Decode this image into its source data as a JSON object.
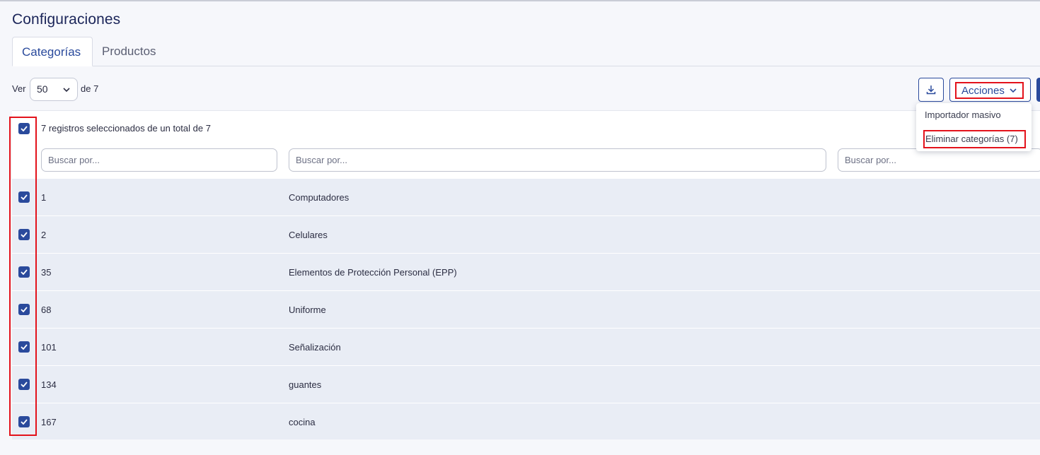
{
  "page": {
    "title": "Configuraciones"
  },
  "tabs": [
    {
      "label": "Categorías",
      "active": true
    },
    {
      "label": "Productos",
      "active": false
    }
  ],
  "pagination": {
    "ver_label": "Ver",
    "page_size": "50",
    "of_label": "de 7"
  },
  "toolbar": {
    "download_icon": "download-icon",
    "actions_label": "Acciones"
  },
  "actions_menu": {
    "items": [
      "Importador masivo",
      "Eliminar categorías (7)"
    ]
  },
  "table": {
    "selection_summary": "7 registros seleccionados de un total de 7",
    "filters": [
      {
        "placeholder": "Buscar por..."
      },
      {
        "placeholder": "Buscar por..."
      },
      {
        "placeholder": "Buscar por..."
      }
    ],
    "rows": [
      {
        "id": "1",
        "name": "Computadores",
        "checked": true
      },
      {
        "id": "2",
        "name": "Celulares",
        "checked": true
      },
      {
        "id": "35",
        "name": "Elementos de Protección Personal (EPP)",
        "checked": true
      },
      {
        "id": "68",
        "name": "Uniforme",
        "checked": true
      },
      {
        "id": "101",
        "name": "Señalización",
        "checked": true
      },
      {
        "id": "134",
        "name": "guantes",
        "checked": true
      },
      {
        "id": "167",
        "name": "cocina",
        "checked": true
      }
    ]
  },
  "colors": {
    "accent": "#2a4a9c",
    "highlight": "#e3121b",
    "row_background": "#e9edf5"
  }
}
